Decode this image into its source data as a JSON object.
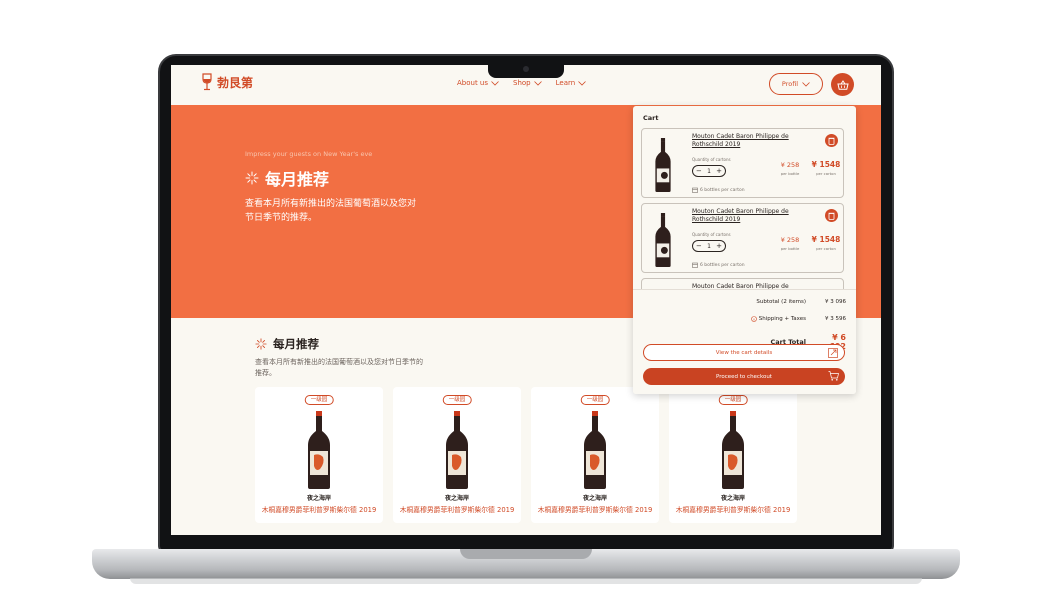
{
  "header": {
    "logo_text": "勃艮第",
    "nav": [
      {
        "label": "About us"
      },
      {
        "label": "Shop"
      },
      {
        "label": "Learn"
      }
    ],
    "profile_label": "Profil"
  },
  "hero": {
    "eyebrow": "Impress your guests on New Year's eve",
    "title": "每月推荐",
    "description": "查看本月所有新推出的法国葡萄酒以及您对节日季节的推荐。"
  },
  "section": {
    "title": "每月推荐",
    "description": "查看本月所有新推出的法国葡萄酒以及您对节日季节的推荐。"
  },
  "products": [
    {
      "badge": "一级园",
      "name": "夜之海岸",
      "subtitle": "木桐嘉穆男爵菲利普罗斯柴尔德 2019"
    },
    {
      "badge": "一级园",
      "name": "夜之海岸",
      "subtitle": "木桐嘉穆男爵菲利普罗斯柴尔德 2019"
    },
    {
      "badge": "一级园",
      "name": "夜之海岸",
      "subtitle": "木桐嘉穆男爵菲利普罗斯柴尔德 2019"
    },
    {
      "badge": "一级园",
      "name": "夜之海岸",
      "subtitle": "木桐嘉穆男爵菲利普罗斯柴尔德 2019"
    }
  ],
  "cart": {
    "title": "Cart",
    "items": [
      {
        "name": "Mouton Cadet Baron Philippe de Rothschild 2019",
        "qty_label": "Quantity of cartons",
        "qty": "1",
        "price": "¥ 258",
        "price_label": "per bottle",
        "total": "¥ 1548",
        "total_label": "per carton",
        "carton_note": "6 bottles per carton"
      },
      {
        "name": "Mouton Cadet Baron Philippe de Rothschild 2019",
        "qty_label": "Quantity of cartons",
        "qty": "1",
        "price": "¥ 258",
        "price_label": "per bottle",
        "total": "¥ 1548",
        "total_label": "per carton",
        "carton_note": "6 bottles per carton"
      },
      {
        "name": "Mouton Cadet Baron Philippe de"
      }
    ],
    "subtotal_label": "Subtotal (2 items)",
    "subtotal_value": "¥ 3 096",
    "shipping_label": "Shipping + Taxes",
    "shipping_value": "¥ 3 596",
    "total_label": "Cart Total",
    "total_value": "¥ 6 692",
    "view_details_label": "View the cart details",
    "checkout_label": "Proceed to checkout"
  },
  "colors": {
    "accent": "#d14b27",
    "hero_bg": "#f26f43",
    "page_bg": "#faf8f2"
  }
}
